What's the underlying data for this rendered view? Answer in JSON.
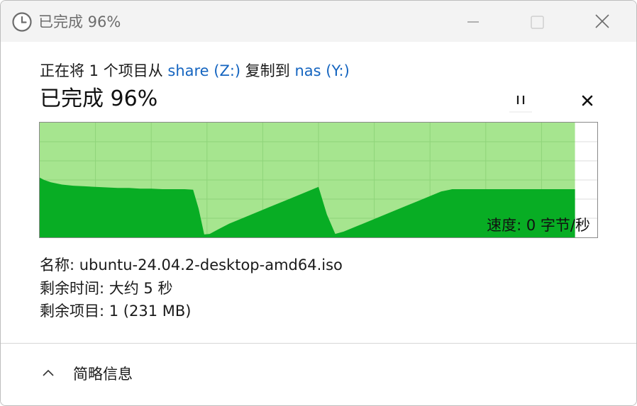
{
  "window": {
    "title": "已完成 96%"
  },
  "copy": {
    "prefix": "正在将 1 个项目从 ",
    "source": "share (Z:)",
    "middle": " 复制到 ",
    "destination": "nas (Y:)"
  },
  "progress": {
    "title": "已完成 96%",
    "percent": 96,
    "speed": "速度: 0 字节/秒"
  },
  "details": {
    "name": "名称:  ubuntu-24.04.2-desktop-amd64.iso",
    "time_remaining": "剩余时间:  大约 5 秒",
    "items_remaining": "剩余项目:  1 (231 MB)"
  },
  "footer": {
    "toggle_label": "简略信息"
  },
  "colors": {
    "progress_fill": "#a6e58f",
    "speed_fill": "#08ad24",
    "grid_line": "#8fd47a",
    "link": "#1565c0"
  },
  "icons": {
    "title": "clock-icon",
    "pause": "pause-icon",
    "cancel": "close-icon",
    "toggle": "chevron-up-icon"
  },
  "chart_data": {
    "type": "area",
    "title": "",
    "xlabel": "",
    "ylabel": "",
    "xlim": [
      0,
      100
    ],
    "ylim": [
      0,
      100
    ],
    "grid": true,
    "progress_percent": 96,
    "series": [
      {
        "x": [
          0,
          0.8,
          2,
          4,
          6,
          8,
          10,
          12,
          14,
          16,
          18,
          20,
          22,
          24,
          26,
          27.5,
          28.5,
          29.5,
          30.5,
          32,
          34,
          36,
          38,
          40,
          42,
          44,
          46,
          48,
          50,
          51.5,
          53,
          54.5,
          56,
          58,
          60,
          62,
          64,
          66,
          68,
          70,
          72,
          74,
          76,
          78,
          80,
          82,
          84,
          86,
          88,
          90,
          92,
          94,
          96
        ],
        "y": [
          52,
          50,
          48,
          46,
          45,
          44.5,
          44,
          43.5,
          43,
          43,
          42.5,
          42.5,
          42,
          42,
          42,
          41.5,
          25,
          2.5,
          3,
          7,
          12,
          16,
          20,
          24,
          28,
          32,
          36,
          40,
          44,
          20,
          3,
          5,
          8,
          12,
          16,
          20,
          24,
          28,
          32,
          36,
          40,
          42,
          42,
          42,
          42,
          42,
          42,
          42,
          42,
          42,
          42,
          42,
          42
        ]
      }
    ]
  }
}
